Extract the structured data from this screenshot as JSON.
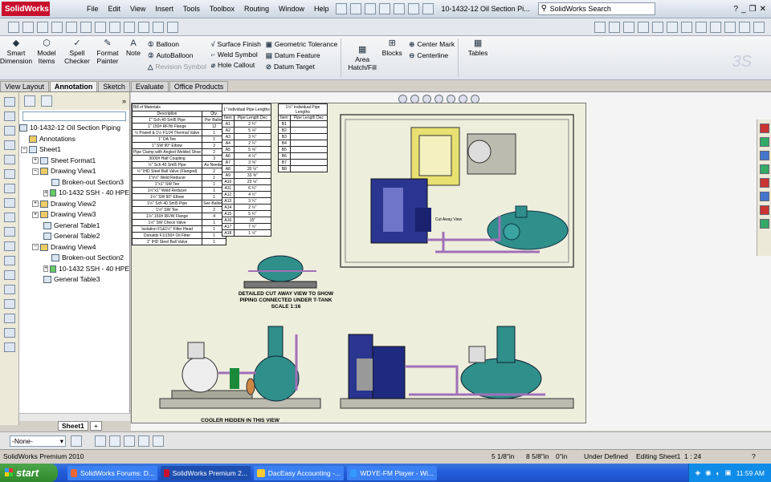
{
  "app": {
    "logo": "SolidWorks",
    "title": "10-1432-12 Oil Section Pi...",
    "search_placeholder": "SolidWorks Search",
    "help_q": "?"
  },
  "menu": [
    "File",
    "Edit",
    "View",
    "Insert",
    "Tools",
    "Toolbox",
    "Routing",
    "Window",
    "Help"
  ],
  "commands": {
    "smart_dimension": "Smart Dimension",
    "model_items": "Model Items",
    "spell_checker": "Spell Checker",
    "format_painter": "Format Painter",
    "note": "Note",
    "balloon": "Balloon",
    "autoballoon": "AutoBalloon",
    "revision_symbol": "Revision Symbol",
    "surface_finish": "Surface Finish",
    "weld_symbol": "Weld Symbol",
    "hole_callout": "Hole Callout",
    "geometric_tolerance": "Geometric Tolerance",
    "datum_feature": "Datum Feature",
    "datum_target": "Datum Target",
    "area_hatch": "Area Hatch/Fill",
    "blocks": "Blocks",
    "center_mark": "Center Mark",
    "centerline": "Centerline",
    "tables": "Tables"
  },
  "tabs": [
    "View Layout",
    "Annotation",
    "Sketch",
    "Evaluate",
    "Office Products"
  ],
  "tree": {
    "root": "10-1432-12 Oil Section Piping",
    "annotations": "Annotations",
    "sheet1": "Sheet1",
    "sheet_format": "Sheet Format1",
    "view1": "Drawing View1",
    "broken1": "Broken-out Section3",
    "comp1": "10-1432 SSH - 40 HPE",
    "view2": "Drawing View2",
    "view3": "Drawing View3",
    "table1": "General Table1",
    "table2": "General Table2",
    "view4": "Drawing View4",
    "broken2": "Broken-out Section2",
    "comp2": "10-1432 SSH - 40 HPE",
    "table3": "General Table3"
  },
  "sheet_tab": "Sheet1",
  "drawing": {
    "bom_title": "Bill of Materials",
    "bom_headers": [
      "Description",
      "Qty."
    ],
    "bom_rows": [
      [
        "1\" Sch 40 Sml5 Pipe",
        "Per Ballon"
      ],
      [
        "1\" 150# RF/W Flange",
        "12"
      ],
      [
        "½ Powell & 1½ F1/J4 Thermal Valve",
        "1"
      ],
      [
        "1\" DA Tee",
        "1"
      ],
      [
        "1\" SW 90° Elbow",
        "3"
      ],
      [
        "Pipe Clamp with Angled Welded Shoe",
        "2"
      ],
      [
        "3000# Half Coupling",
        "3"
      ],
      [
        "½\" Sch 40 Sml5 Pipe",
        "As Needed"
      ],
      [
        "½\" IHD Steel Ball Valve (Flanged)",
        "2"
      ],
      [
        "1\"x½\" Weld Reducer",
        "1"
      ],
      [
        "1\"x1\" SW Tee",
        "1"
      ],
      [
        "1½\"x1\" Weld Reducer",
        "1"
      ],
      [
        "1½\" SW 90° Elbow",
        "1"
      ],
      [
        "1½\" Sch 40 Sml5 Pipe",
        "See Balloon"
      ],
      [
        "1½\" SW Tee",
        "2"
      ],
      [
        "1½\" 150# RF/W Flange",
        "4"
      ],
      [
        "1½\" SW Check Valve",
        "1"
      ],
      [
        "Isolation F1&1½\" Filter Head",
        "1"
      ],
      [
        "Donalds F1/150# Oil Filter",
        "1"
      ],
      [
        "1\" IHD Steel Ball Valve",
        "1"
      ]
    ],
    "len1_title": "1\" Individual Pipe Lengths",
    "len2_title": "1½\" Individual Pipe Lengths",
    "len_headers": [
      "Item",
      "Pipe Length Dec"
    ],
    "len1_rows": [
      [
        "A1",
        "2 ¾\""
      ],
      [
        "A2",
        "5 ⅛\""
      ],
      [
        "A3",
        "3 ¾\""
      ],
      [
        "A4",
        "2 ¾\""
      ],
      [
        "A5",
        "5 ⅜\""
      ],
      [
        "A6",
        "4 ½\""
      ],
      [
        "A7",
        "3 ⅜\""
      ],
      [
        "A8",
        "20 ⅛\""
      ],
      [
        "A9",
        "33 ⅜\""
      ],
      [
        "A10",
        "23 ⅛\""
      ],
      [
        "A11",
        "6 ¾\""
      ],
      [
        "A12",
        "4 ½\""
      ],
      [
        "A13",
        "3 ¾\""
      ],
      [
        "A14",
        "2 ½\""
      ],
      [
        "A15",
        "5 ¾\""
      ],
      [
        "A16",
        "15\""
      ],
      [
        "A17",
        "7 ½\""
      ],
      [
        "A18",
        "1 ½\""
      ]
    ],
    "len2_rows": [
      [
        "B1",
        ""
      ],
      [
        "B2",
        ""
      ],
      [
        "B3",
        ""
      ],
      [
        "B4",
        ""
      ],
      [
        "B5",
        ""
      ],
      [
        "B6",
        ""
      ],
      [
        "B7",
        ""
      ],
      [
        "B8",
        ""
      ]
    ],
    "detail_caption": "DETAILED CUT AWAY VIEW TO SHOW PIPING CONNECTED UNDER T-TANK SCALE 1:16",
    "cooler_caption": "COOLER HIDDEN IN THIS VIEW",
    "cut_label": "Cut Away View"
  },
  "bottom": {
    "layer": "-None-"
  },
  "status": {
    "product": "SolidWorks Premium 2010",
    "x": "5 1/8\"in",
    "y": "8 5/8\"in",
    "z": "0\"in",
    "state": "Under Defined",
    "editing": "Editing Sheet1",
    "scale": "1 : 24",
    "help": "?"
  },
  "taskbar": {
    "start": "start",
    "tasks": [
      "SolidWorks Forums: D...",
      "SolidWorks Premium 2...",
      "DacEasy Accounting -...",
      "WDYE-FM Player - Wi..."
    ],
    "clock": "11:59 AM"
  },
  "colors": {
    "teal": "#2f8f8a",
    "navy": "#2a3590",
    "purple": "#a070b8",
    "sheet": "#eeeedd"
  }
}
